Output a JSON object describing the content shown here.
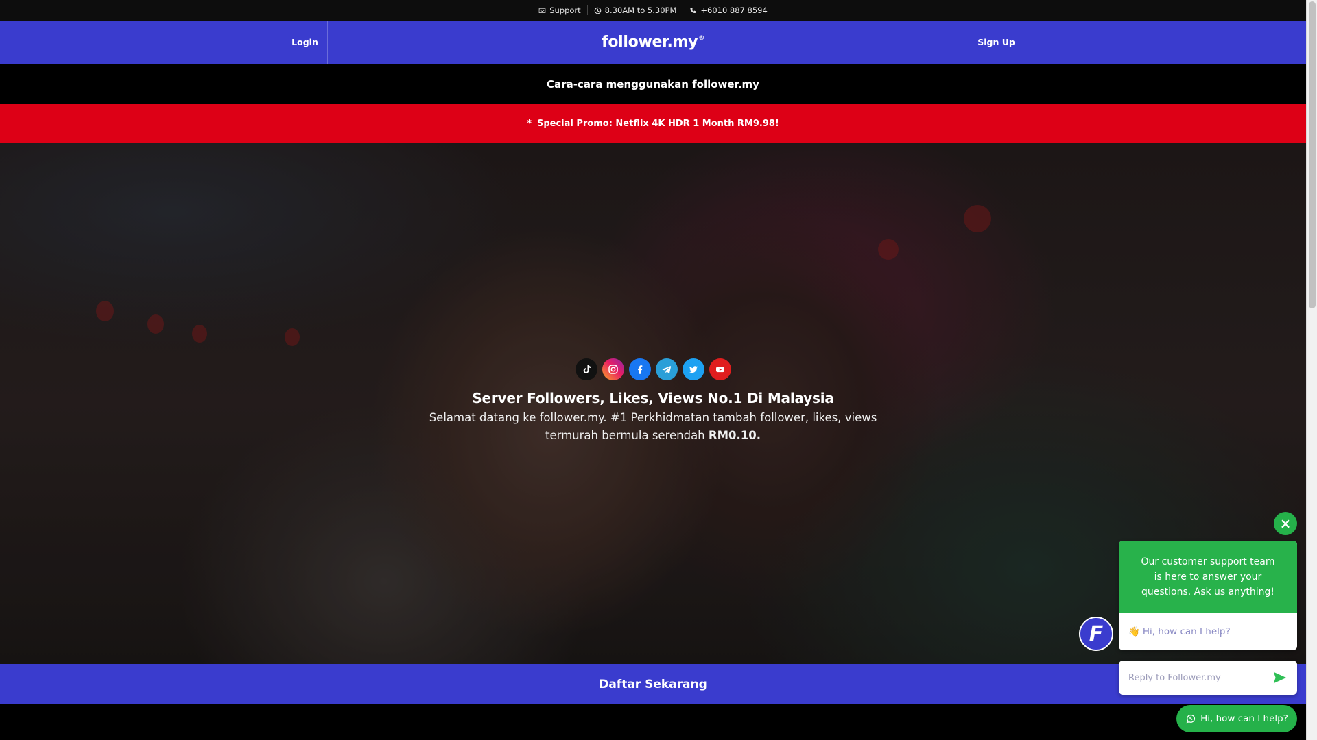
{
  "topbar": {
    "support": "Support",
    "hours": "8.30AM to 5.30PM",
    "phone": "+6010 887 8594"
  },
  "nav": {
    "login": "Login",
    "logo": "follower.my",
    "logo_mark": "®",
    "signup": "Sign Up"
  },
  "howto": "Cara-cara menggunakan follower.my",
  "promo": {
    "icon": "*",
    "text": "Special Promo: Netflix 4K HDR 1 Month RM9.98!"
  },
  "hero": {
    "socials": [
      "tiktok-icon",
      "instagram-icon",
      "facebook-icon",
      "telegram-icon",
      "twitter-icon",
      "youtube-icon"
    ],
    "title": "Server Followers, Likes, Views No.1 Di Malaysia",
    "subtitle": "Selamat datang ke follower.my. #1 Perkhidmatan tambah follower, likes, views termurah bermula serendah",
    "price": "RM0.10."
  },
  "cta": "Daftar Sekarang",
  "chat": {
    "close": "×",
    "message": "Our customer support team is here to answer your questions. Ask us anything!",
    "greeting_emoji": "👋",
    "greeting": "Hi, how can I help?",
    "avatar_letter": "F",
    "reply_placeholder": "Reply to Follower.my",
    "whatsapp_label": "Hi, how can I help?"
  },
  "colors": {
    "brand_blue": "#3a3cce",
    "promo_red": "#dd0016",
    "chat_green": "#28b24b"
  }
}
